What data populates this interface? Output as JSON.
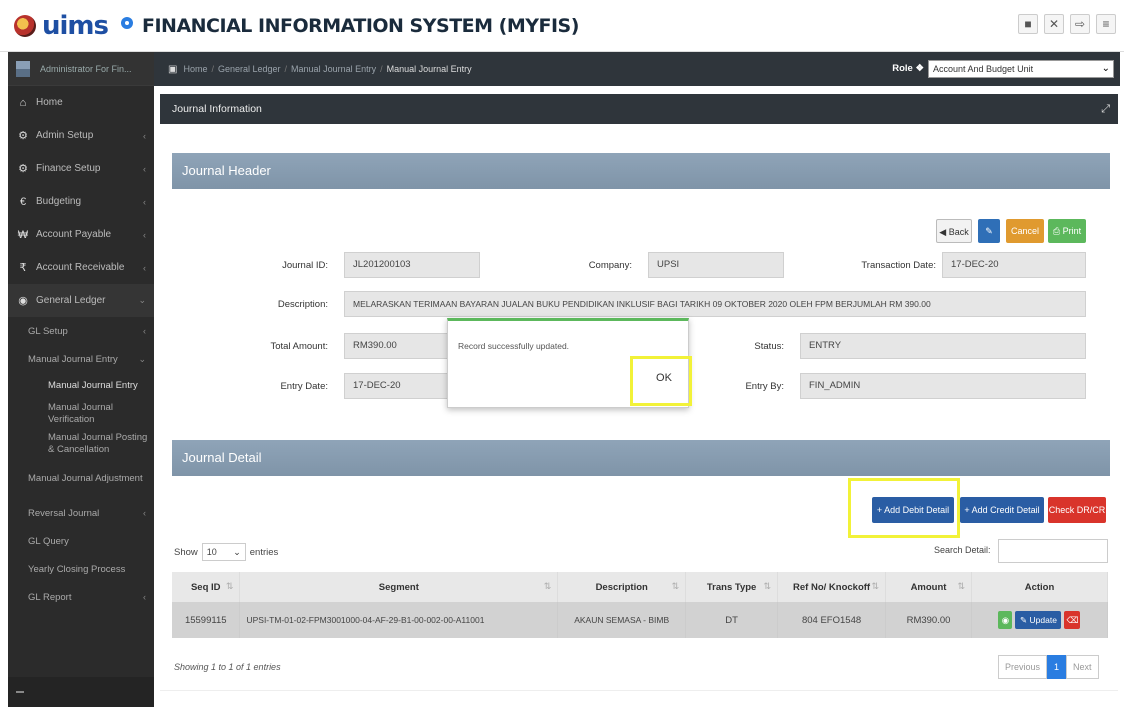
{
  "header": {
    "logo": "uims",
    "logo_prefix": "",
    "title": "FINANCIAL INFORMATION SYSTEM (MYFIS)"
  },
  "user": {
    "name": "Administrator For Fin..."
  },
  "breadcrumb": [
    "Home",
    "General Ledger",
    "Manual Journal Entry",
    "Manual Journal Entry"
  ],
  "role": {
    "label": "Role",
    "value": "Account And Budget Unit"
  },
  "sidebar": {
    "items": [
      {
        "label": "Home",
        "icon": "home-icon"
      },
      {
        "label": "Admin Setup",
        "icon": "gears-icon"
      },
      {
        "label": "Finance Setup",
        "icon": "gear-icon"
      },
      {
        "label": "Budgeting",
        "icon": "euro-icon"
      },
      {
        "label": "Account Payable",
        "icon": "won-icon"
      },
      {
        "label": "Account Receivable",
        "icon": "rupee-icon"
      },
      {
        "label": "General Ledger",
        "icon": "globe-icon"
      }
    ],
    "gl_sub": [
      "GL Setup",
      "Manual Journal Entry"
    ],
    "mje_sub": [
      "Manual Journal Entry",
      "Manual Journal Verification",
      "Manual Journal Posting & Cancellation"
    ],
    "gl_sub2": [
      "Manual Journal Adjustment",
      "Reversal Journal",
      "GL Query",
      "Yearly Closing Process",
      "GL Report"
    ]
  },
  "panel": {
    "title": "Journal Information"
  },
  "journal_header": {
    "title": "Journal Header",
    "buttons": {
      "back": "Back",
      "cancel": "Cancel",
      "print": "Print"
    },
    "fields": {
      "journal_id_label": "Journal ID:",
      "journal_id": "JL201200103",
      "company_label": "Company:",
      "company": "UPSI",
      "transaction_date_label": "Transaction Date:",
      "transaction_date": "17-DEC-20",
      "description_label": "Description:",
      "description": "MELARASKAN TERIMAAN BAYARAN JUALAN BUKU PENDIDIKAN INKLUSIF BAGI TARIKH 09 OKTOBER 2020 OLEH FPM BERJUMLAH RM 390.00",
      "total_amount_label": "Total Amount:",
      "total_amount": "RM390.00",
      "status_label": "Status:",
      "status": "ENTRY",
      "entry_date_label": "Entry Date:",
      "entry_date": "17-DEC-20",
      "entry_by_label": "Entry By:",
      "entry_by": "FIN_ADMIN"
    }
  },
  "modal": {
    "message": "Record successfully updated.",
    "ok": "OK"
  },
  "journal_detail": {
    "title": "Journal Detail",
    "buttons": {
      "add_debit": "+ Add Debit Detail",
      "add_credit": "+ Add Credit Detail",
      "check": "Check DR/CR"
    },
    "show_label": "Show",
    "entries_value": "10",
    "entries_label": "entries",
    "search_label": "Search Detail:",
    "columns": [
      "Seq ID",
      "Segment",
      "Description",
      "Trans Type",
      "Ref No/ Knockoff",
      "Amount",
      "Action"
    ],
    "rows": [
      {
        "seq_id": "15599115",
        "segment": "UPSI-TM-01-02-FPM3001000-04-AF-29-B1-00-002-00-A11001",
        "description": "AKAUN SEMASA - BIMB",
        "trans_type": "DT",
        "ref_no": "804 EFO1548",
        "amount": "RM390.00",
        "update": "Update"
      }
    ],
    "showing": "Showing 1 to 1 of 1 entries",
    "pager": {
      "previous": "Previous",
      "page": "1",
      "next": "Next"
    }
  },
  "colors": {
    "sidebar": "#2b2b2b",
    "section_header": "#8fa4b8",
    "primary": "#2a5da4",
    "danger": "#d9342b",
    "success": "#5cb85c",
    "warning": "#e09a2f",
    "highlight": "#f2f238"
  }
}
